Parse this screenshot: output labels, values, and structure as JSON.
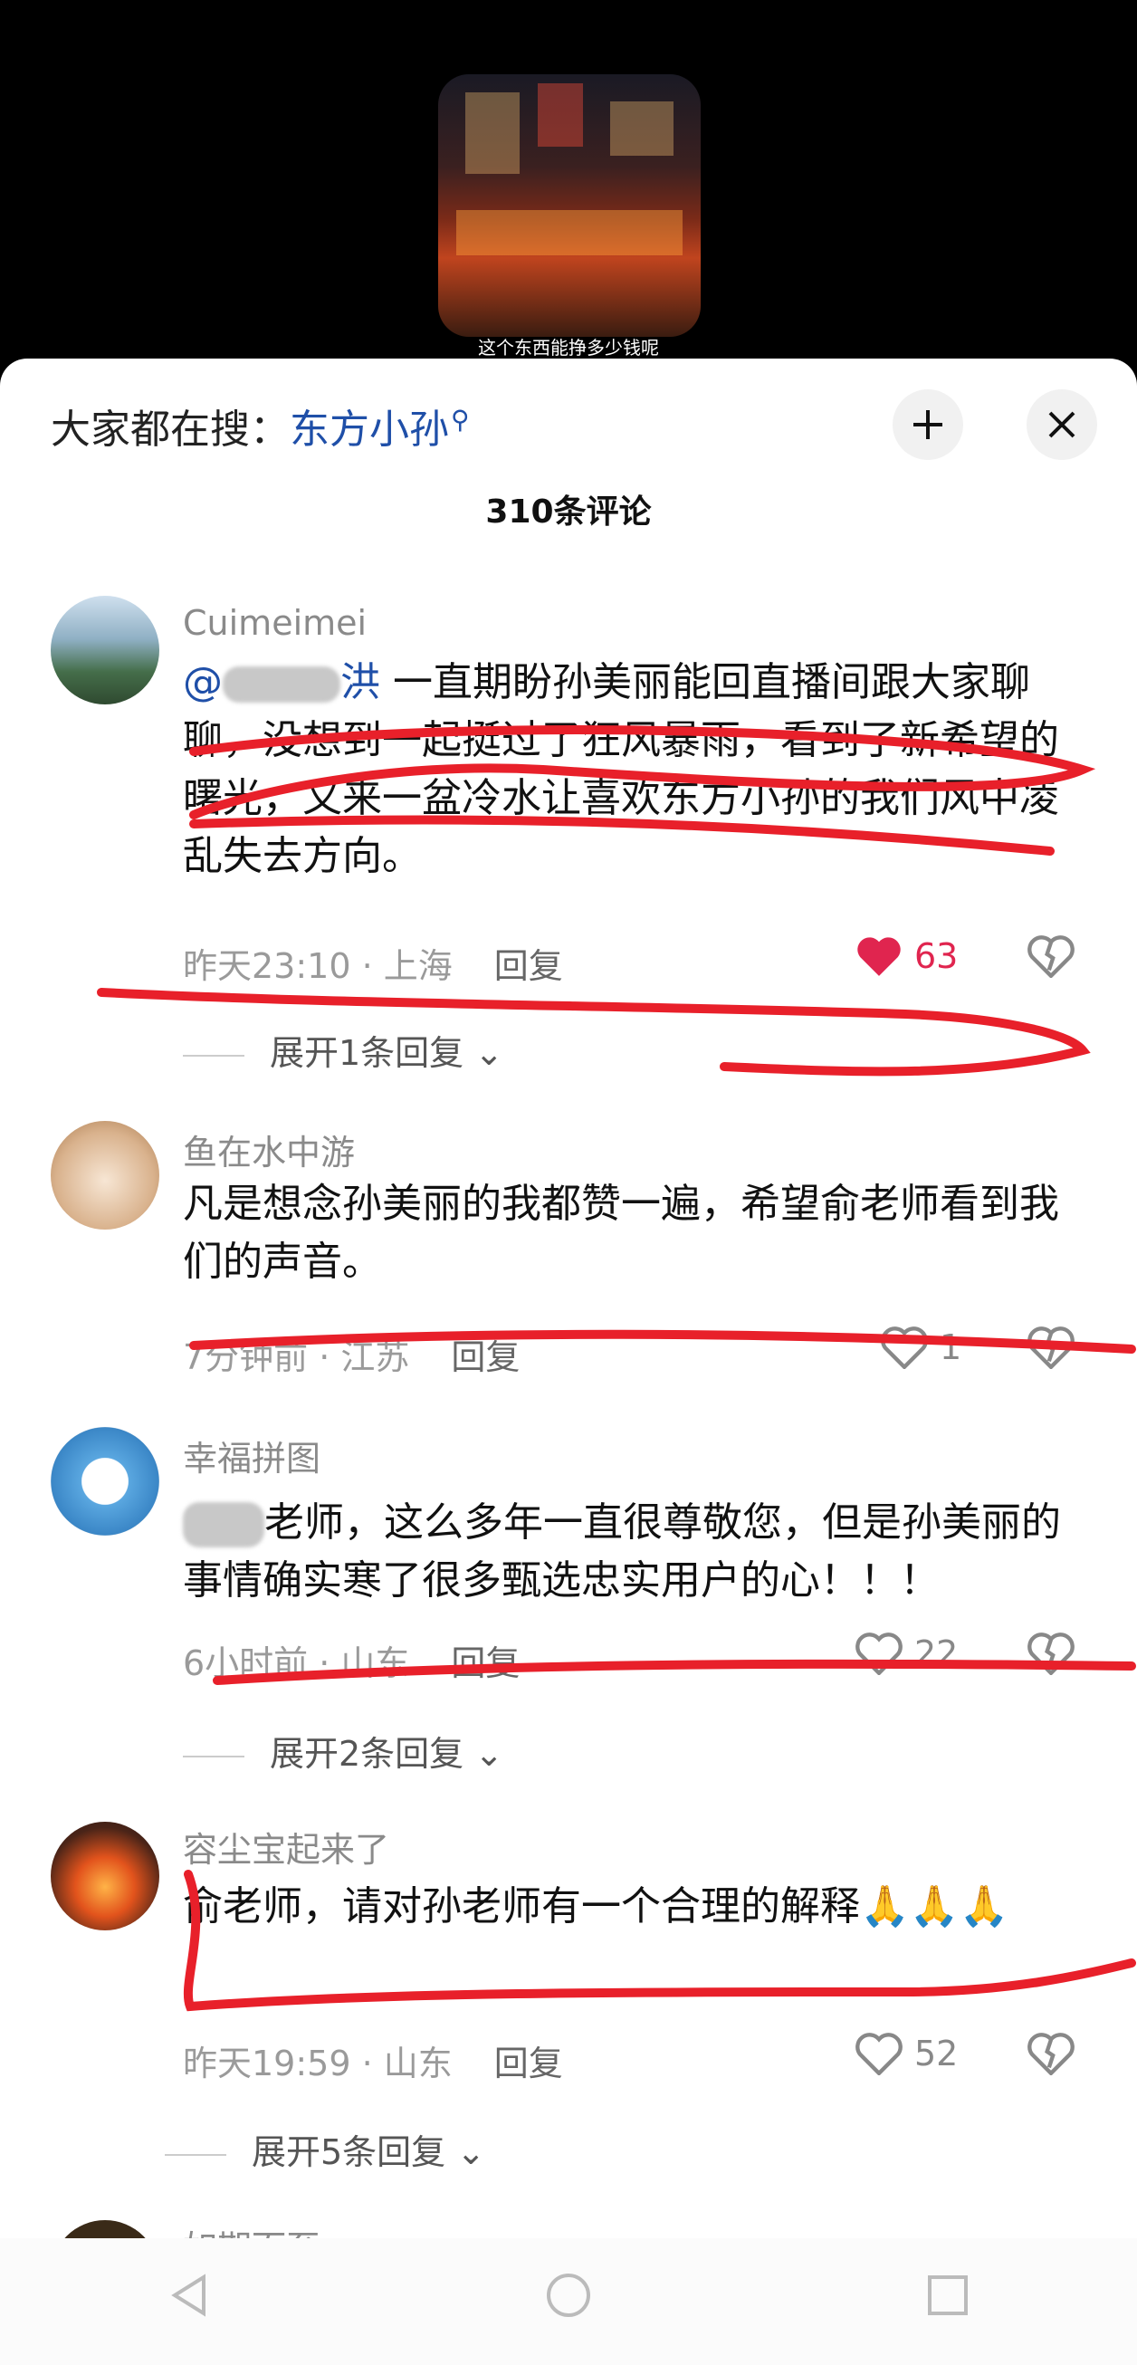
{
  "video": {
    "caption": "这个东西能挣多少钱呢"
  },
  "header": {
    "search_prefix": "大家都在搜：",
    "search_term": "东方小孙",
    "search_icon": "magnifier-icon",
    "collapse_icon": "collapse-icon",
    "close_icon": "close-icon",
    "comment_count": "310条评论"
  },
  "comments": [
    {
      "user": "Cuimeimei",
      "mention": "@",
      "mention_suffix": "洪",
      "text": " 一直期盼孙美丽能回直播间跟大家聊聊，没想到一起挺过了狂风暴雨，看到了新希望的曙光，又来一盆冷水让喜欢东方小孙的我们风中凌乱失去方向。",
      "time": "昨天23:10 · 上海",
      "reply": "回复",
      "likes": "63",
      "expand": "展开1条回复"
    },
    {
      "user": "鱼在水中游",
      "text": "凡是想念孙美丽的我都赞一遍，希望俞老师看到我们的声音。",
      "time": "7分钟前 · 江苏",
      "reply": "回复",
      "likes": "1"
    },
    {
      "user": "幸福拼图",
      "text": "老师，这么多年一直很尊敬您，但是孙美丽的事情确实寒了很多甄选忠实用户的心！！！",
      "time": "6小时前 · 山东",
      "reply": "回复",
      "likes": "22",
      "expand": "展开2条回复"
    },
    {
      "user": "容尘宝起来了",
      "text": "俞老师，请对孙老师有一个合理的解释🙏🙏🙏",
      "time": "昨天19:59 · 山东",
      "reply": "回复",
      "likes": "52",
      "expand": "展开5条回复"
    },
    {
      "user": "如期而至"
    }
  ],
  "colors": {
    "accent": "#1f4fa8",
    "like_red": "#e0254f",
    "annotation_red": "#e8202a"
  },
  "navbar": {
    "back": "back-icon",
    "home": "home-icon",
    "recents": "recents-icon"
  }
}
